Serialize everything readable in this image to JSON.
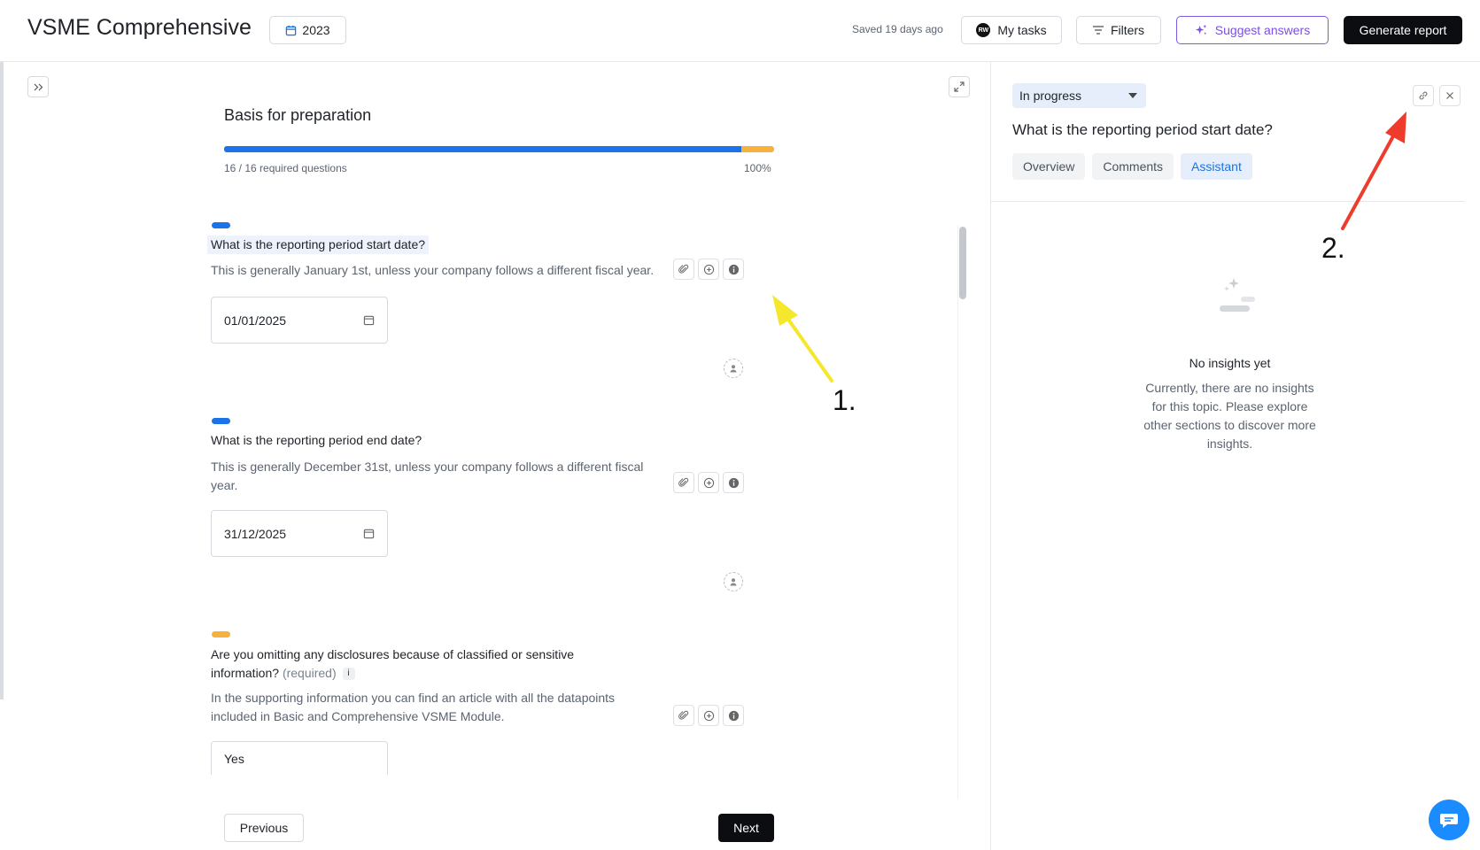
{
  "header": {
    "title": "VSME Comprehensive",
    "year": "2023",
    "saved_text": "Saved 19 days ago",
    "avatar_initials": "RW",
    "my_tasks": "My tasks",
    "filters": "Filters",
    "suggest": "Suggest answers",
    "generate": "Generate report"
  },
  "section": {
    "title": "Basis for preparation",
    "progress_text": "16 / 16 required questions",
    "progress_percent": "100%",
    "progress_blue_fraction": 0.94,
    "progress_orange_fraction": 0.06
  },
  "questions": [
    {
      "pill_color": "#1a73e8",
      "title": "What is the reporting period start date?",
      "description": "This is generally January 1st, unless your company follows a different fiscal year.",
      "value": "01/01/2025"
    },
    {
      "pill_color": "#1a73e8",
      "title": "What is the reporting period end date?",
      "description_line1": "This is generally December 31st, unless your company follows a different fiscal",
      "description_line2": "year.",
      "value": "31/12/2025"
    },
    {
      "pill_color": "#f6b23c",
      "title_line1": "Are you omitting any disclosures because of classified or sensitive",
      "title_line2": "information?",
      "required": "(required)",
      "info": "i",
      "description_line1": "In the supporting information you can find an article with all the datapoints",
      "description_line2": "included in Basic and Comprehensive VSME Module.",
      "value": "Yes"
    }
  ],
  "nav": {
    "previous": "Previous",
    "next": "Next"
  },
  "right_panel": {
    "status": "In progress",
    "question": "What is the reporting period start date?",
    "tabs": [
      "Overview",
      "Comments",
      "Assistant"
    ],
    "active_tab": "Assistant",
    "empty_title": "No insights yet",
    "empty_text": "Currently, there are no insights for this topic. Please explore other sections to discover more insights."
  },
  "annotations": {
    "label1": "1.",
    "label2": "2.",
    "arrow1_color": "#f5e72b",
    "arrow2_color": "#ef3b2c"
  },
  "colors": {
    "accent_blue": "#1a73e8",
    "accent_orange": "#f6b23c",
    "suggest_purple": "#7c4fe0",
    "dark": "#0b0d10"
  }
}
